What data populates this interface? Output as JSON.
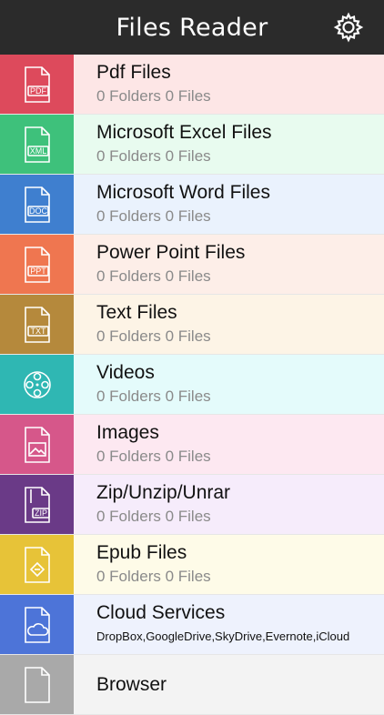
{
  "header": {
    "title": "Files Reader"
  },
  "rows": [
    {
      "name": "Pdf Files",
      "sub": "0  Folders 0  Files",
      "icon_label": "PDF",
      "icon": "pdf-file-icon",
      "color": "#dd4a5c",
      "bg": "#fde6e6"
    },
    {
      "name": "Microsoft Excel Files",
      "sub": "0  Folders 0  Files",
      "icon_label": "XML",
      "icon": "excel-file-icon",
      "color": "#3ec17b",
      "bg": "#e8fbef"
    },
    {
      "name": "Microsoft Word Files",
      "sub": "0  Folders 0  Files",
      "icon_label": "DOC",
      "icon": "word-file-icon",
      "color": "#3f7fcf",
      "bg": "#eaf2fd"
    },
    {
      "name": "Power Point Files",
      "sub": "0  Folders 0  Files",
      "icon_label": "PPT",
      "icon": "powerpoint-file-icon",
      "color": "#ef7650",
      "bg": "#fdeee8"
    },
    {
      "name": "Text Files",
      "sub": "0  Folders 0  Files",
      "icon_label": "TXT",
      "icon": "text-file-icon",
      "color": "#b5893c",
      "bg": "#fdf4e6"
    },
    {
      "name": "Videos",
      "sub": "0  Folders 0  Files",
      "icon_label": "",
      "icon": "video-reel-icon",
      "color": "#2fb7b3",
      "bg": "#e4fbfb"
    },
    {
      "name": "Images",
      "sub": "0  Folders 0  Files",
      "icon_label": "",
      "icon": "image-file-icon",
      "color": "#d6578a",
      "bg": "#fde8f1"
    },
    {
      "name": "Zip/Unzip/Unrar",
      "sub": "0  Folders 0  Files",
      "icon_label": "ZIP",
      "icon": "zip-file-icon",
      "color": "#6a3a87",
      "bg": "#f6ecfb"
    },
    {
      "name": "Epub Files",
      "sub": "0  Folders 0  Files",
      "icon_label": "",
      "icon": "epub-file-icon",
      "color": "#e7c338",
      "bg": "#fefbe8"
    },
    {
      "name": "Cloud Services",
      "sub": "DropBox,GoogleDrive,SkyDrive,Evernote,iCloud",
      "icon_label": "",
      "icon": "cloud-file-icon",
      "color": "#4d74d8",
      "bg": "#eef2fd"
    },
    {
      "name": "Browser",
      "sub": "",
      "icon_label": "",
      "icon": "browser-file-icon",
      "color": "#a9a9a9",
      "bg": "#f3f3f3"
    }
  ]
}
